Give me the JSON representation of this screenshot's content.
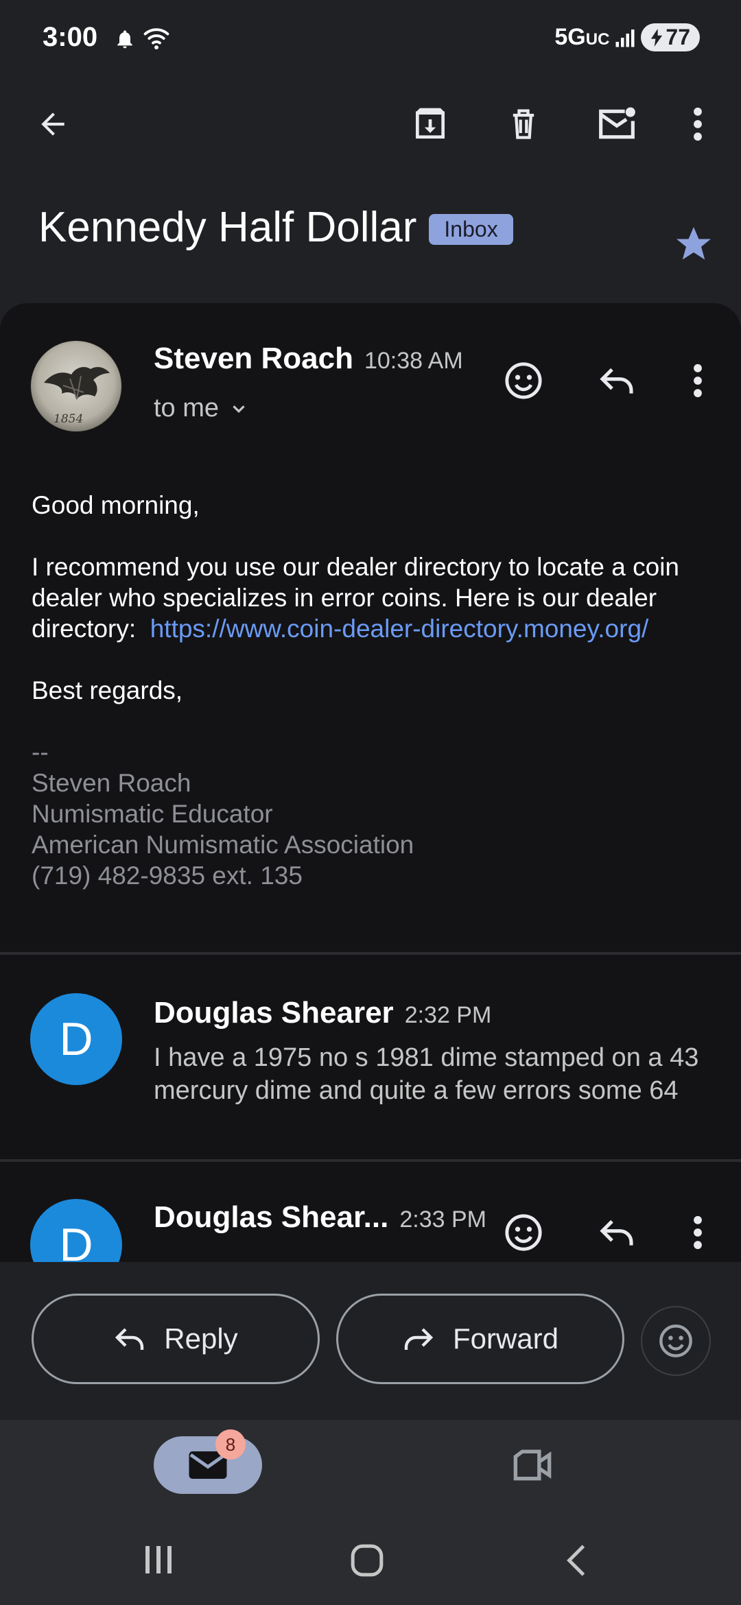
{
  "status": {
    "time": "3:00",
    "network": "5G",
    "network_sub": "UC",
    "battery": "77"
  },
  "toolbar": {
    "back_icon": "arrow-left-icon",
    "archive_icon": "archive-icon",
    "delete_icon": "trash-icon",
    "unread_icon": "mark-unread-icon",
    "more_icon": "more-vert-icon"
  },
  "subject": {
    "title": "Kennedy Half Dollar",
    "label": "Inbox",
    "starred": true
  },
  "message1": {
    "sender": "Steven Roach",
    "time": "10:38 AM",
    "recipient": "to me",
    "avatar_text": "1854",
    "greeting": "Good morning,",
    "paragraph": "I recommend you use our dealer directory to locate a coin dealer who specializes in error coins. Here is our dealer directory:",
    "link": "https://www.coin-dealer-directory.money.org/",
    "closing": "Best regards,",
    "sig_dash": "--",
    "sig_lines": [
      "Steven Roach",
      "Numismatic Educator",
      "American Numismatic Association",
      "(719) 482-9835 ext. 135"
    ]
  },
  "message2": {
    "initial": "D",
    "sender": "Douglas Shearer",
    "time": "2:32 PM",
    "snippet": "I have a 1975 no s 1981 dime stamped on a 43 mercury dime and quite a few errors some 64"
  },
  "message3": {
    "initial": "D",
    "sender": "Douglas Shear...",
    "time": "2:33 PM"
  },
  "actions": {
    "reply": "Reply",
    "forward": "Forward"
  },
  "nav": {
    "mail_badge": "8"
  },
  "colors": {
    "link": "#6b9bf5",
    "star": "#8ea3de",
    "avatar_d": "#1c8adb",
    "badge_bg": "#8ea3de"
  }
}
